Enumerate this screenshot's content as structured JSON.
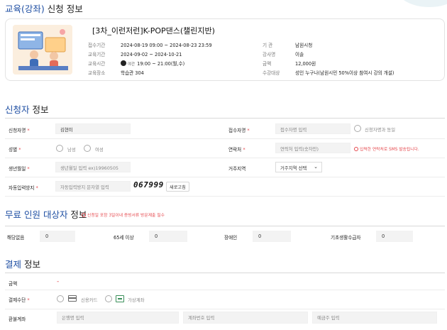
{
  "page": {
    "section1_hl": "교육(강좌)",
    "section1_rest": " 신청 정보"
  },
  "course": {
    "title": "[3차_이런저런]K-POP댄스(챌린지반)",
    "left": [
      {
        "key": "접수기간",
        "value": "2024-08-19 09:00 ~ 2024-08-23 23:59"
      },
      {
        "key": "교육기간",
        "value": "2024-09-02 ~ 2024-10-21"
      },
      {
        "key": "교육시간",
        "badge": "야간",
        "value": "19:00 ~ 21:00(월,수)"
      },
      {
        "key": "교육장소",
        "value": "학습관 304"
      }
    ],
    "right": [
      {
        "key": "기 관",
        "value": "남원시청"
      },
      {
        "key": "강사명",
        "value": "이솔"
      },
      {
        "key": "금액",
        "value": "12,000원"
      },
      {
        "key": "수강대상",
        "value": "성인 누구나(남원시민 50%이상 참여시 강의 개설)"
      }
    ]
  },
  "applicant": {
    "title_hl": "신청자",
    "title_rest": " 정보",
    "name_label": "신청자명",
    "name_value": "김현미",
    "receiver_label": "접수자명",
    "receiver_placeholder": "접수자명 입력",
    "same_label": "신청자명과 동일",
    "gender_label": "성별",
    "male": "남성",
    "female": "여성",
    "contact_label": "연락처",
    "contact_placeholder": "연락처 입력(숫자만)",
    "contact_warn": "입력한 연락처로 SMS 발송됩니다.",
    "birth_label": "생년월일",
    "birth_placeholder": "생년월일 입력 ex)19960505",
    "region_label": "거주지역",
    "region_value": "거주지역 선택",
    "captcha_label": "자동입력방지",
    "captcha_placeholder": "자동입력방지 문자열 입력",
    "captcha_text": "067999",
    "refresh_label": "새로고침"
  },
  "free": {
    "title_hl": "무료 인원 대상자",
    "title_rest": " 정보",
    "warn": "신청일 포함 3일이내 증빙서류 방문제출 필수",
    "items": [
      {
        "label": "해당없음",
        "value": "0"
      },
      {
        "label": "65세 이상",
        "value": "0"
      },
      {
        "label": "장애인",
        "value": "0"
      },
      {
        "label": "기초생활수급자",
        "value": "0"
      }
    ]
  },
  "payment": {
    "title_hl": "결제",
    "title_rest": " 정보",
    "amount_label": "금액",
    "amount_value": "-",
    "method_label": "결제수단",
    "card_label": "신용카드",
    "vacct_label": "가상계좌",
    "refund_label": "환불계좌",
    "bank_placeholder": "은행명 입력",
    "account_placeholder": "계좌번호 입력",
    "holder_placeholder": "예금주 입력"
  },
  "colors": {
    "accent": "#1f4fa3",
    "required": "#e5484d"
  }
}
